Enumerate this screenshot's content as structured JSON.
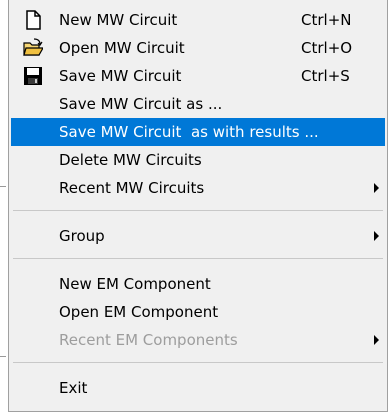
{
  "menu": {
    "items": [
      {
        "label": "New MW Circuit",
        "shortcut": "Ctrl+N",
        "icon": "new-document-icon"
      },
      {
        "label": "Open MW Circuit",
        "shortcut": "Ctrl+O",
        "icon": "open-folder-icon"
      },
      {
        "label": "Save MW Circuit",
        "shortcut": "Ctrl+S",
        "icon": "floppy-disk-icon"
      },
      {
        "label": "Save MW Circuit as ...",
        "shortcut": ""
      },
      {
        "label": "Save MW Circuit  as with results ...",
        "shortcut": "",
        "selected": true
      },
      {
        "label": "Delete MW Circuits",
        "shortcut": ""
      },
      {
        "label": "Recent MW Circuits",
        "shortcut": "",
        "submenu": true
      },
      {
        "label": "Group",
        "shortcut": "",
        "submenu": true
      },
      {
        "label": "New EM Component",
        "shortcut": ""
      },
      {
        "label": "Open EM Component",
        "shortcut": ""
      },
      {
        "label": "Recent EM Components",
        "shortcut": "",
        "submenu": true,
        "disabled": true
      },
      {
        "label": "Exit",
        "shortcut": ""
      }
    ]
  },
  "colors": {
    "menu_background": "#f0f0f0",
    "highlight": "#0078d7",
    "highlight_text": "#ffffff",
    "disabled_text": "#9d9d9d"
  }
}
